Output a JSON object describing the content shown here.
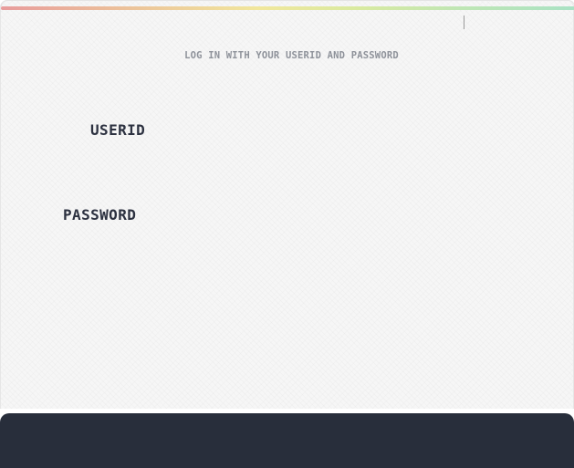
{
  "header": {
    "subtitle": "LOG IN WITH YOUR USERID AND PASSWORD"
  },
  "form": {
    "userid": {
      "label": "USERID",
      "value": "",
      "placeholder": ""
    },
    "password": {
      "label": "PASSWORD",
      "value": "",
      "placeholder": ""
    }
  },
  "colors": {
    "card_background": "#f6f6f6",
    "label_text": "#2c3140",
    "subtitle_text": "#8e929a",
    "footer_bar": "#282e3b",
    "rainbow_start": "#e89c9c",
    "rainbow_mid": "#f1e79c",
    "rainbow_end": "#a9e2c4"
  }
}
